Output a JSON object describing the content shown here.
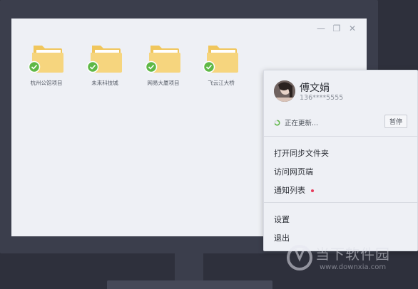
{
  "window": {
    "controls": {
      "minimize": "—",
      "restore": "❐",
      "close": "✕"
    }
  },
  "folders": [
    {
      "label": "杭州公馆项目"
    },
    {
      "label": "未来科技城"
    },
    {
      "label": "网易大厦项目"
    },
    {
      "label": "飞云江大桥"
    }
  ],
  "popup": {
    "user_name": "傅文娟",
    "user_phone": "136****5555",
    "sync_status": "正在更新...",
    "pause_label": "暂停",
    "menu1": [
      "打开同步文件夹",
      "访问网页端",
      "通知列表"
    ],
    "menu2": [
      "设置",
      "退出"
    ]
  },
  "watermark": {
    "name": "当下软件园",
    "url": "www.downxia.com"
  },
  "colors": {
    "folder": "#f6d57e",
    "check": "#5fb846",
    "notify_dot": "#e73c5c"
  }
}
